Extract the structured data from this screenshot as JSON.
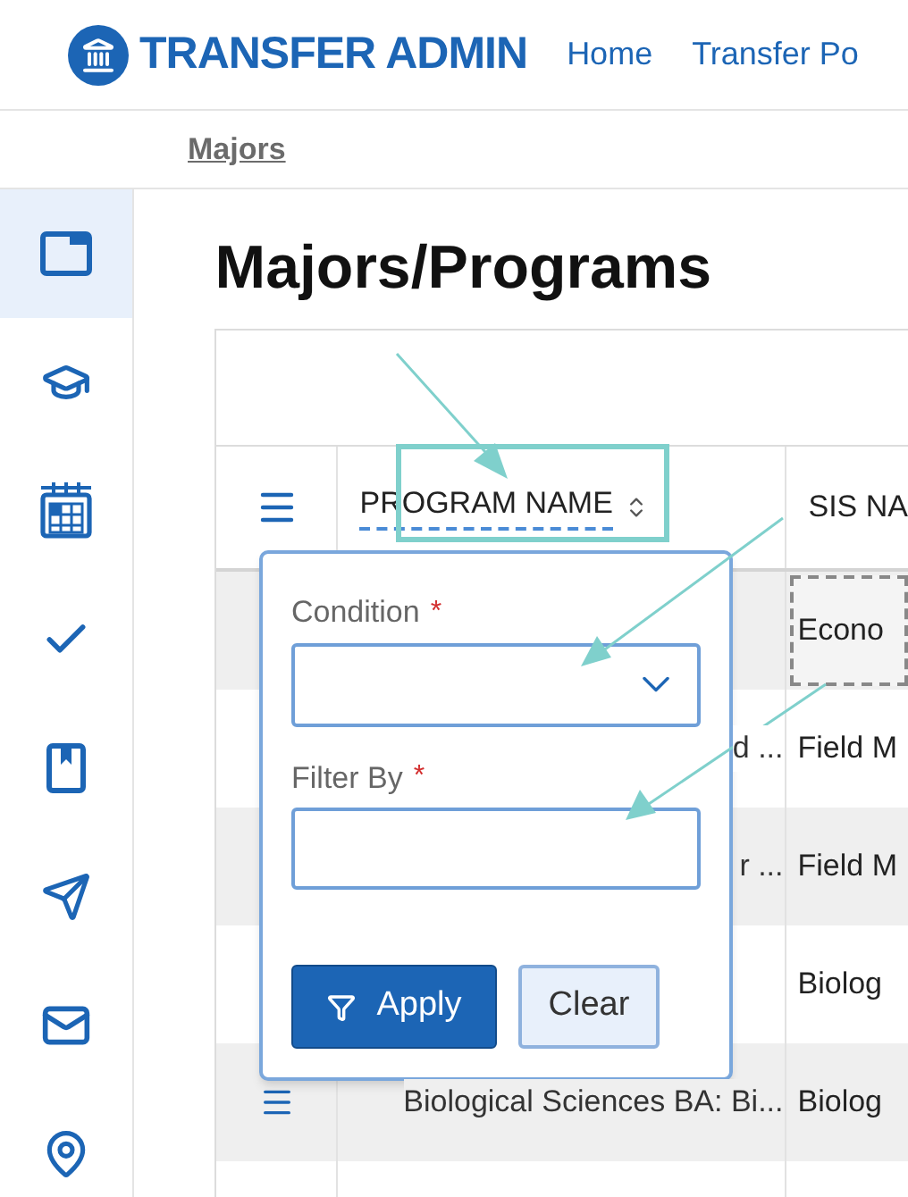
{
  "header": {
    "title": "TRANSFER ADMIN",
    "nav": [
      {
        "label": "Home"
      },
      {
        "label": "Transfer Po"
      }
    ]
  },
  "breadcrumb": "Majors",
  "sidebar": {
    "items": [
      {
        "kind": "window",
        "selected": true
      },
      {
        "kind": "cap",
        "selected": false
      },
      {
        "kind": "calendar",
        "selected": false
      },
      {
        "kind": "check",
        "selected": false
      },
      {
        "kind": "book",
        "selected": false
      },
      {
        "kind": "send",
        "selected": false
      },
      {
        "kind": "mail",
        "selected": false
      },
      {
        "kind": "pin",
        "selected": false
      }
    ]
  },
  "page_title": "Majors/Programs",
  "table": {
    "columns": [
      {
        "label": "PROGRAM NAME",
        "sortable": true
      },
      {
        "label": "SIS NA",
        "sortable": false
      }
    ],
    "rows": [
      {
        "sis_name": "Econo",
        "focused": true,
        "handle": false
      },
      {
        "program_name": "d ...",
        "sis_name": "Field M",
        "focused": false,
        "handle": false
      },
      {
        "program_name": "r ...",
        "sis_name": "Field M",
        "focused": false,
        "handle": false
      },
      {
        "sis_name": "Biolog",
        "focused": false,
        "handle": false
      },
      {
        "program_name": "Biological Sciences BA: Bi...",
        "sis_name": "Biolog",
        "focused": false,
        "handle": true
      },
      {
        "focused": false
      }
    ]
  },
  "filter_popup": {
    "fields": [
      {
        "kind": "select",
        "label": "Condition",
        "required_mark": "*"
      },
      {
        "kind": "text",
        "label": "Filter By",
        "required_mark": "*"
      }
    ],
    "buttons": [
      {
        "kind": "primary",
        "label": "Apply"
      },
      {
        "kind": "secondary",
        "label": "Clear"
      }
    ]
  }
}
